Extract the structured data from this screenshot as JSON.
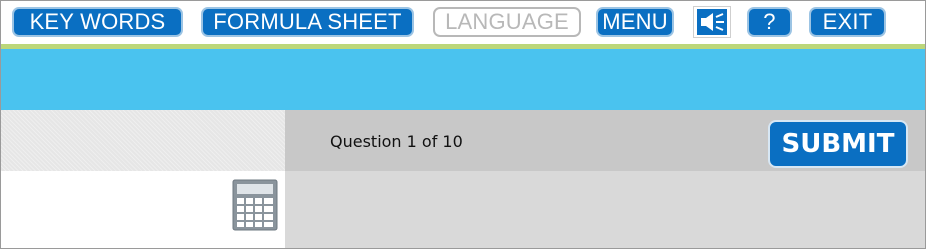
{
  "toolbar": {
    "key_words": "KEY WORDS",
    "formula_sheet": "FORMULA SHEET",
    "language": "LANGUAGE",
    "menu": "MENU",
    "help": "?",
    "exit": "EXIT",
    "audio_icon": "speaker-muted-icon"
  },
  "question": {
    "counter": "Question 1 of 10",
    "submit_label": "SUBMIT"
  },
  "tools": {
    "calculator_icon": "calculator-icon"
  },
  "colors": {
    "button_blue": "#0a6fc2",
    "accent_green": "#bcd77a",
    "header_band": "#4ac3ef",
    "question_bar": "#c8c8c8",
    "content_bg": "#d9d9d9"
  }
}
